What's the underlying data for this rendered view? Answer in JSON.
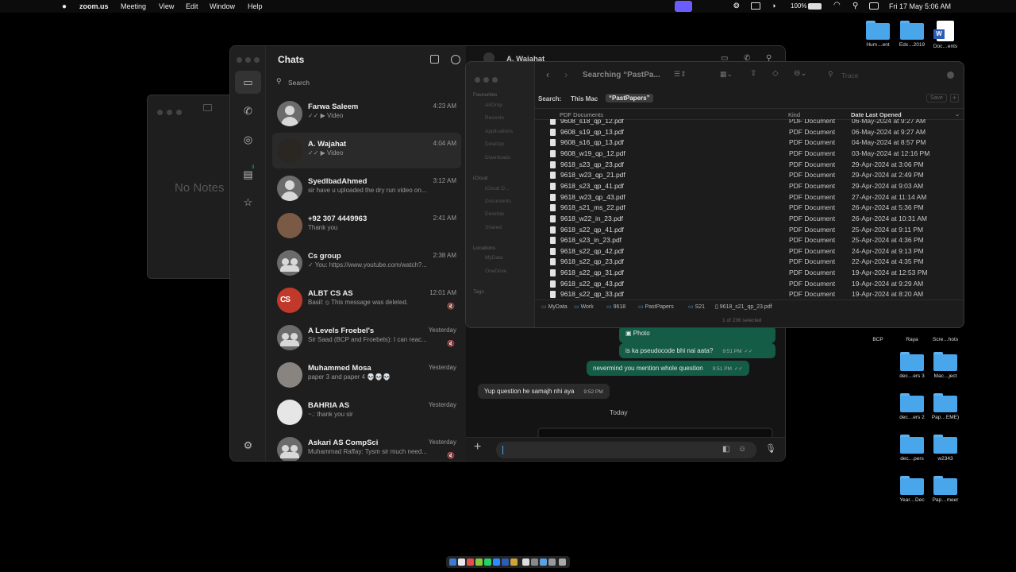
{
  "menubar": {
    "app": "zoom.us",
    "items": [
      "Meeting",
      "View",
      "Edit",
      "Window",
      "Help"
    ],
    "battery": "100%",
    "datetime": "Fri 17 May  5:06 AM"
  },
  "desktop": {
    "top_icons": [
      {
        "label": "Hum…ent",
        "kind": "folder"
      },
      {
        "label": "Edx…2019",
        "kind": "folder"
      },
      {
        "label": "Doc…ents",
        "kind": "word"
      }
    ],
    "icons": [
      {
        "label": "BCP"
      },
      {
        "label": "Raya"
      },
      {
        "label": "Scre…hots"
      },
      {
        "label": "dec…ers 3"
      },
      {
        "label": "Mac…ject"
      },
      {
        "label": "dec…ers 2"
      },
      {
        "label": "Pap…EME)"
      },
      {
        "label": "dec…pers"
      },
      {
        "label": "w2343"
      },
      {
        "label": "Year…Dec"
      },
      {
        "label": "Pap…meer"
      }
    ]
  },
  "notes": {
    "empty_text": "No Notes"
  },
  "whatsapp": {
    "title": "Chats",
    "search_placeholder": "Search",
    "starred_badge": "3",
    "header_contact": "A. Wajahat",
    "chats": [
      {
        "name": "Farwa Saleem",
        "preview": "✓✓ ▶ Video",
        "time": "4:23 AM",
        "avatar": "person",
        "muted": false
      },
      {
        "name": "A. Wajahat",
        "preview": "✓✓ ▶ Video",
        "time": "4:04 AM",
        "avatar": "photo-dark",
        "muted": false
      },
      {
        "name": "SyedIbadAhmed",
        "preview": "sir have u uploaded the dry run video on...",
        "time": "3:12 AM",
        "avatar": "person",
        "muted": false
      },
      {
        "name": "+92 307 4449963",
        "preview": "Thank you",
        "time": "2:41 AM",
        "avatar": "photo-brown",
        "muted": false
      },
      {
        "name": "Cs group",
        "preview": "✓ You: https://www.youtube.com/watch?...",
        "time": "2:38 AM",
        "avatar": "group",
        "muted": false
      },
      {
        "name": "ALBT CS AS",
        "preview": "Basil: ⦸ This message was deleted.",
        "time": "12:01 AM",
        "avatar": "cs-logo",
        "muted": true
      },
      {
        "name": "A Levels Froebel's",
        "preview": "Sir Saad (BCP and Froebels): I can reac...",
        "time": "Yesterday",
        "avatar": "group",
        "muted": true
      },
      {
        "name": "Muhammed Mosa",
        "preview": "paper 3 and paper 4 💀💀💀",
        "time": "Yesterday",
        "avatar": "photo-grey",
        "muted": false
      },
      {
        "name": "BAHRIA AS",
        "preview": "~.: thank you sir",
        "time": "Yesterday",
        "avatar": "photo-white",
        "muted": false
      },
      {
        "name": "Askari AS CompSci",
        "preview": "Muhammad Raffay: Tysm sir much need...",
        "time": "Yesterday",
        "avatar": "group",
        "muted": true
      }
    ],
    "messages": [
      {
        "text": "Photo",
        "dir": "out",
        "time": ""
      },
      {
        "text": "is ka pseudocode bhi nai aata?",
        "dir": "out",
        "time": "9:51 PM"
      },
      {
        "text": "nevermind you mention whole question",
        "dir": "out",
        "time": "9:51 PM"
      },
      {
        "text": "Yup question he samajh nhi aya",
        "dir": "in",
        "time": "9:52 PM"
      }
    ],
    "date_divider": "Today"
  },
  "finder": {
    "title": "Searching “PastPa...",
    "search_field": "Trace",
    "search_label": "Search:",
    "scope_mac": "This Mac",
    "scope_folder": "“PastPapers”",
    "save_label": "Save",
    "columns": {
      "name": "PDF Documents",
      "kind": "Kind",
      "date": "Date Last Opened"
    },
    "sidebar": {
      "favourites": "Favourites",
      "fav_items": [
        "AirDrop",
        "Recents",
        "Applications",
        "Desktop",
        "Downloads"
      ],
      "icloud": "iCloud",
      "icloud_items": [
        "iCloud D...",
        "Documents",
        "Desktop",
        "Shared"
      ],
      "locations": "Locations",
      "loc_items": [
        "MyData",
        "OneDrive"
      ],
      "tags": "Tags"
    },
    "rows": [
      {
        "name": "9608_s18_qp_12.pdf",
        "kind": "PDF Document",
        "date": "06-May-2024 at 9:27 AM"
      },
      {
        "name": "9608_s19_qp_13.pdf",
        "kind": "PDF Document",
        "date": "06-May-2024 at 9:27 AM"
      },
      {
        "name": "9608_s16_qp_13.pdf",
        "kind": "PDF Document",
        "date": "04-May-2024 at 8:57 PM"
      },
      {
        "name": "9608_w19_qp_12.pdf",
        "kind": "PDF Document",
        "date": "03-May-2024 at 12:16 PM"
      },
      {
        "name": "9618_s23_qp_23.pdf",
        "kind": "PDF Document",
        "date": "29-Apr-2024 at 3:06 PM"
      },
      {
        "name": "9618_w23_qp_21.pdf",
        "kind": "PDF Document",
        "date": "29-Apr-2024 at 2:49 PM"
      },
      {
        "name": "9618_s23_qp_41.pdf",
        "kind": "PDF Document",
        "date": "29-Apr-2024 at 9:03 AM"
      },
      {
        "name": "9618_w23_qp_43.pdf",
        "kind": "PDF Document",
        "date": "27-Apr-2024 at 11:14 AM"
      },
      {
        "name": "9618_s21_ms_22.pdf",
        "kind": "PDF Document",
        "date": "26-Apr-2024 at 5:36 PM"
      },
      {
        "name": "9618_w22_in_23.pdf",
        "kind": "PDF Document",
        "date": "26-Apr-2024 at 10:31 AM"
      },
      {
        "name": "9618_s22_qp_41.pdf",
        "kind": "PDF Document",
        "date": "25-Apr-2024 at 9:11 PM"
      },
      {
        "name": "9618_s23_in_23.pdf",
        "kind": "PDF Document",
        "date": "25-Apr-2024 at 4:36 PM"
      },
      {
        "name": "9618_s22_qp_42.pdf",
        "kind": "PDF Document",
        "date": "24-Apr-2024 at 9:13 PM"
      },
      {
        "name": "9618_s22_qp_23.pdf",
        "kind": "PDF Document",
        "date": "22-Apr-2024 at 4:35 PM"
      },
      {
        "name": "9618_s22_qp_31.pdf",
        "kind": "PDF Document",
        "date": "19-Apr-2024 at 12:53 PM"
      },
      {
        "name": "9618_s22_qp_43.pdf",
        "kind": "PDF Document",
        "date": "19-Apr-2024 at 9:29 AM"
      },
      {
        "name": "9618_s22_qp_33.pdf",
        "kind": "PDF Document",
        "date": "19-Apr-2024 at 8:20 AM"
      }
    ],
    "path": [
      "MyData",
      "Work",
      "9618",
      "PastPapers",
      "S21",
      "9618_s21_qp_23.pdf"
    ],
    "status": "1 of 236 selected"
  },
  "colors": {
    "accent_blue": "#4aa6ea",
    "outgoing_bubble": "#145c46",
    "zoom_icon": "#6b5cff"
  }
}
